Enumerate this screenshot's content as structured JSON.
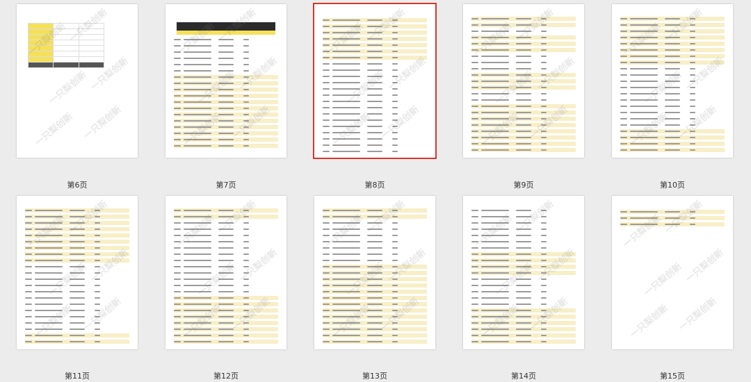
{
  "pages": [
    {
      "label": "第6页",
      "selected": false
    },
    {
      "label": "第7页",
      "selected": false
    },
    {
      "label": "第8页",
      "selected": true
    },
    {
      "label": "第9页",
      "selected": false
    },
    {
      "label": "第10页",
      "selected": false
    },
    {
      "label": "第11页",
      "selected": false
    },
    {
      "label": "第12页",
      "selected": false
    },
    {
      "label": "第13页",
      "selected": false
    },
    {
      "label": "第14页",
      "selected": false
    },
    {
      "label": "第15页",
      "selected": false
    }
  ],
  "watermark": "一只梨创新",
  "colors": {
    "selected_border": "#d9342b",
    "row_highlight": "#f8efc8",
    "header_yellow": "#f5e05a"
  }
}
